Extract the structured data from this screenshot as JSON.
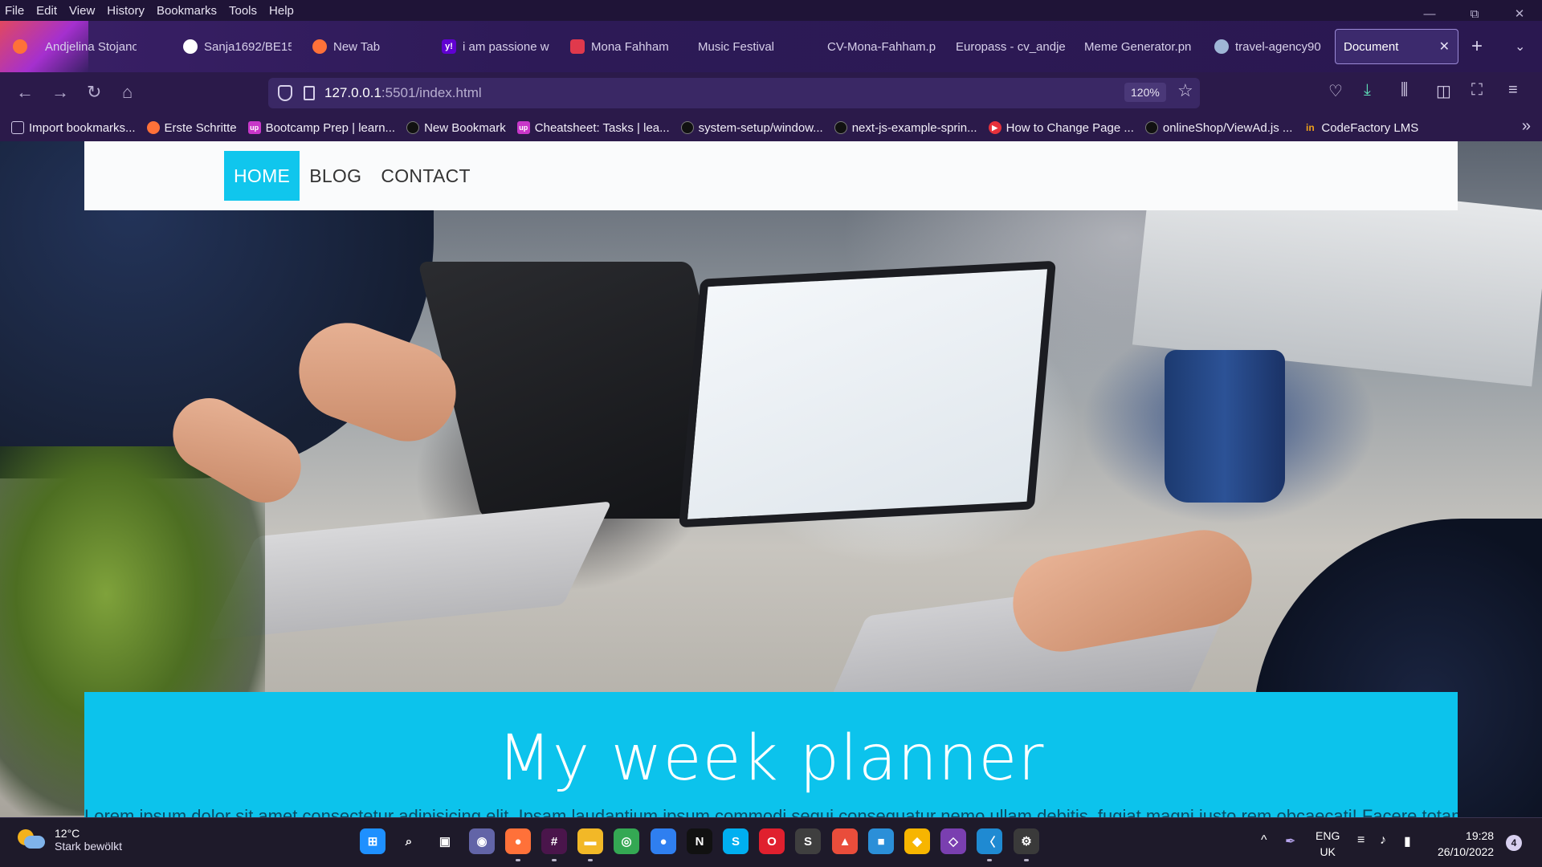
{
  "menubar": {
    "items": [
      "File",
      "Edit",
      "View",
      "History",
      "Bookmarks",
      "Tools",
      "Help"
    ]
  },
  "window_controls": {
    "minimize": "—",
    "restore": "⧉",
    "close": "✕"
  },
  "tabs": [
    {
      "label": "Andjelina Stojanovi",
      "icon": "user-avatar-icon",
      "color": "#8b6fcf"
    },
    {
      "label": "Sanja1692/BE15",
      "icon": "github-icon",
      "color": "#ffffff"
    },
    {
      "label": "New Tab",
      "icon": "firefox-icon",
      "color": "#ff7139"
    },
    {
      "label": "i am passione w",
      "icon": "yahoo-icon",
      "color": "#6001d2"
    },
    {
      "label": "Mona Fahham",
      "icon": "briefcase-icon",
      "color": "#e0394c"
    },
    {
      "label": "Music Festival",
      "icon": "",
      "color": ""
    },
    {
      "label": "CV-Mona-Fahham.p",
      "icon": "",
      "color": ""
    },
    {
      "label": "Europass - cv_andje",
      "icon": "",
      "color": ""
    },
    {
      "label": "Meme Generator.pn",
      "icon": "",
      "color": ""
    },
    {
      "label": "travel-agency90",
      "icon": "globe-icon",
      "color": "#9fb6d6"
    },
    {
      "label": "Document",
      "icon": "",
      "color": "",
      "active": true
    }
  ],
  "tab_close": "✕",
  "new_tab": "+",
  "tab_list": "⌄",
  "navigation": {
    "back": "←",
    "forward": "→",
    "reload": "↻",
    "home": "⌂"
  },
  "urlbar": {
    "host": "127.0.0.1",
    "path": ":5501/index.html",
    "zoom": "120%"
  },
  "toolbar_icons": [
    "pocket-icon",
    "download-icon",
    "library-icon",
    "sidebar-icon",
    "screenshot-icon",
    "menu-icon"
  ],
  "bookmarks": [
    {
      "label": "Import bookmarks...",
      "icon": "import-icon",
      "color": "#cfc8e6"
    },
    {
      "label": "Erste Schritte",
      "icon": "firefox-icon",
      "color": "#ff7139"
    },
    {
      "label": "Bootcamp Prep | learn...",
      "icon": "up-icon",
      "color": "#c837c9"
    },
    {
      "label": "New Bookmark",
      "icon": "github-icon",
      "color": "#111111"
    },
    {
      "label": "Cheatsheet: Tasks | lea...",
      "icon": "up-icon",
      "color": "#c837c9"
    },
    {
      "label": "system-setup/window...",
      "icon": "github-icon",
      "color": "#111111"
    },
    {
      "label": "next-js-example-sprin...",
      "icon": "github-icon",
      "color": "#111111"
    },
    {
      "label": "How to Change Page ...",
      "icon": "youtube-icon",
      "color": "#e6313b"
    },
    {
      "label": "onlineShop/ViewAd.js ...",
      "icon": "github-icon",
      "color": "#111111"
    },
    {
      "label": "CodeFactory LMS",
      "icon": "codefactory-icon",
      "color": "#f0a21a"
    }
  ],
  "bookmarks_overflow": "»",
  "site": {
    "nav": [
      "HOME",
      "BLOG",
      "CONTACT"
    ],
    "hero_title": "My week planner",
    "hero_subtitle": "Lorem ipsum dolor sit amet consectetur adipisicing elit. Ipsam laudantium ipsum commodi sequi consequatur nemo ullam debitis, fugiat magni iusto rem obcaecati! Facere totam dolor.",
    "accent": "#0cc3ec"
  },
  "taskbar": {
    "weather": {
      "temp": "12°C",
      "desc": "Stark bewölkt"
    },
    "apps": [
      {
        "name": "windows-start-icon",
        "glyph": "⊞",
        "color": "#1e90ff"
      },
      {
        "name": "search-icon",
        "glyph": "⌕",
        "color": "transparent"
      },
      {
        "name": "task-view-icon",
        "glyph": "▣",
        "color": "transparent"
      },
      {
        "name": "teams-chat-icon",
        "glyph": "◉",
        "color": "#6264a7"
      },
      {
        "name": "firefox-icon",
        "glyph": "●",
        "color": "#ff7139"
      },
      {
        "name": "slack-icon",
        "glyph": "#",
        "color": "#4a154b"
      },
      {
        "name": "file-explorer-icon",
        "glyph": "▬",
        "color": "#f2b827"
      },
      {
        "name": "chrome-icon",
        "glyph": "◎",
        "color": "#34a853"
      },
      {
        "name": "firefox-dev-icon",
        "glyph": "●",
        "color": "#2f7ff0"
      },
      {
        "name": "netflix-icon",
        "glyph": "N",
        "color": "#111111"
      },
      {
        "name": "skype-icon",
        "glyph": "S",
        "color": "#00aff0"
      },
      {
        "name": "opera-icon",
        "glyph": "O",
        "color": "#e0202e"
      },
      {
        "name": "sublime-text-icon",
        "glyph": "S",
        "color": "#3f3f3f"
      },
      {
        "name": "popcorn-icon",
        "glyph": "▲",
        "color": "#e94d3b"
      },
      {
        "name": "remote-desktop-icon",
        "glyph": "■",
        "color": "#2b8fd8"
      },
      {
        "name": "vpn-shield-icon",
        "glyph": "◆",
        "color": "#f7b500"
      },
      {
        "name": "git-icon",
        "glyph": "◇",
        "color": "#7a3fb0"
      },
      {
        "name": "vscode-icon",
        "glyph": "〈",
        "color": "#1f8ad2"
      },
      {
        "name": "settings-icon",
        "glyph": "⚙",
        "color": "#3a3a3a"
      }
    ],
    "tray": {
      "chevron": "^",
      "pen": "✒",
      "wifi": "≡",
      "volume": "♪",
      "battery": "▮"
    },
    "language": {
      "line1": "ENG",
      "line2": "UK"
    },
    "clock": {
      "time": "19:28",
      "date": "26/10/2022"
    },
    "notifications": "4"
  }
}
